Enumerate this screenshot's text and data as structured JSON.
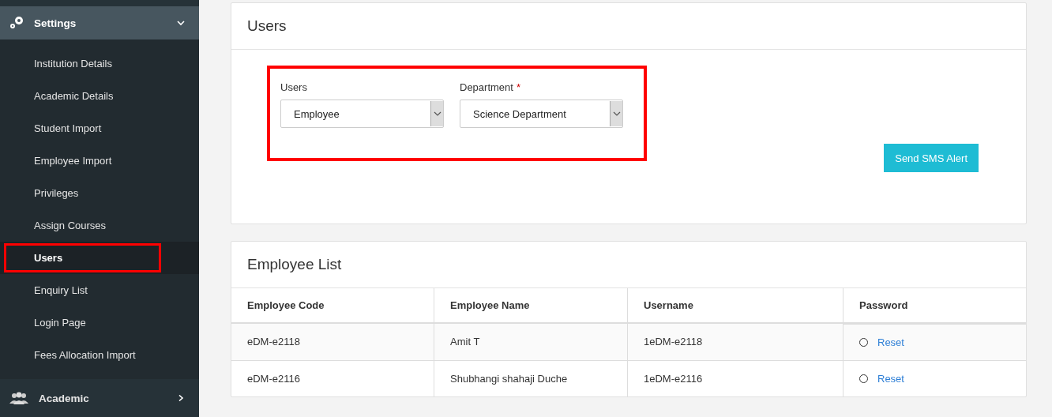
{
  "sidebar": {
    "section": {
      "label": "Settings",
      "expanded": true
    },
    "items": [
      {
        "label": "Institution Details",
        "selected": false
      },
      {
        "label": "Academic Details",
        "selected": false
      },
      {
        "label": "Student Import",
        "selected": false
      },
      {
        "label": "Employee Import",
        "selected": false
      },
      {
        "label": "Privileges",
        "selected": false
      },
      {
        "label": "Assign Courses",
        "selected": false
      },
      {
        "label": "Users",
        "selected": true,
        "highlighted": true
      },
      {
        "label": "Enquiry List",
        "selected": false
      },
      {
        "label": "Login Page",
        "selected": false
      },
      {
        "label": "Fees Allocation Import",
        "selected": false
      }
    ],
    "next_section": {
      "label": "Academic",
      "expanded": false
    }
  },
  "users_panel": {
    "title": "Users",
    "highlighted": true,
    "fields": [
      {
        "label": "Users",
        "value": "Employee"
      },
      {
        "label": "Department",
        "required_mark": "*",
        "value": "Science Department"
      }
    ],
    "button": "Send SMS Alert"
  },
  "employee_list": {
    "title": "Employee List",
    "columns": [
      "Employee Code",
      "Employee Name",
      "Username",
      "Password"
    ],
    "rows": [
      {
        "code": "eDM-e2118",
        "name": "Amit T",
        "username": "1eDM-e2118",
        "selected": false,
        "action": "Reset"
      },
      {
        "code": "eDM-e2116",
        "name": "Shubhangi shahaji Duche",
        "username": "1eDM-e2116",
        "selected": false,
        "action": "Reset"
      }
    ]
  }
}
